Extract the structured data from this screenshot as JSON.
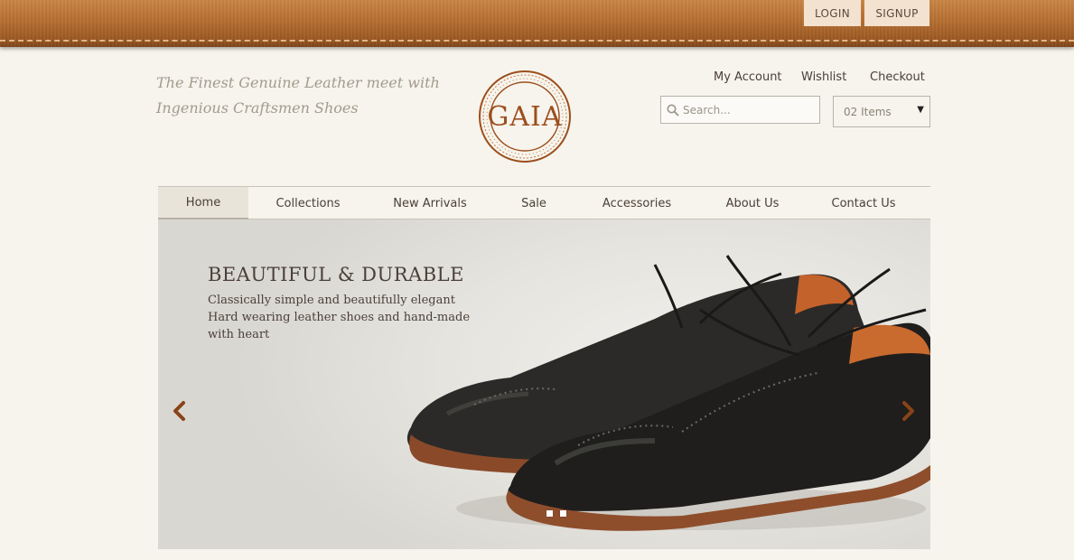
{
  "header": {
    "login_label": "LOGIN",
    "signup_label": "SIGNUP",
    "tagline_line1": "The Finest Genuine Leather meet with",
    "tagline_line2": "Ingenious Craftsmen Shoes",
    "logo_text": "GAIA",
    "links": {
      "account": "My Account",
      "wishlist": "Wishlist",
      "checkout": "Checkout"
    },
    "search_placeholder": "Search...",
    "cart_label": "02 Items"
  },
  "nav": {
    "items": [
      {
        "label": "Home",
        "active": true
      },
      {
        "label": "Collections"
      },
      {
        "label": "New Arrivals"
      },
      {
        "label": "Sale"
      },
      {
        "label": "Accessories"
      },
      {
        "label": "About Us"
      },
      {
        "label": "Contact Us"
      }
    ]
  },
  "hero": {
    "title": "BEAUTIFUL & DURABLE",
    "line1": "Classically simple and beautifully elegant",
    "line2": "Hard wearing leather shoes and hand-made",
    "line3": "with heart",
    "slide_count": 2
  },
  "colors": {
    "accent": "#9c4e1d",
    "leather": "#b56f31",
    "background": "#f6f4ec",
    "button_bg": "#f3e2d0"
  },
  "icons": [
    "search-icon",
    "chevron-down-icon",
    "chevron-left-icon",
    "chevron-right-icon"
  ]
}
